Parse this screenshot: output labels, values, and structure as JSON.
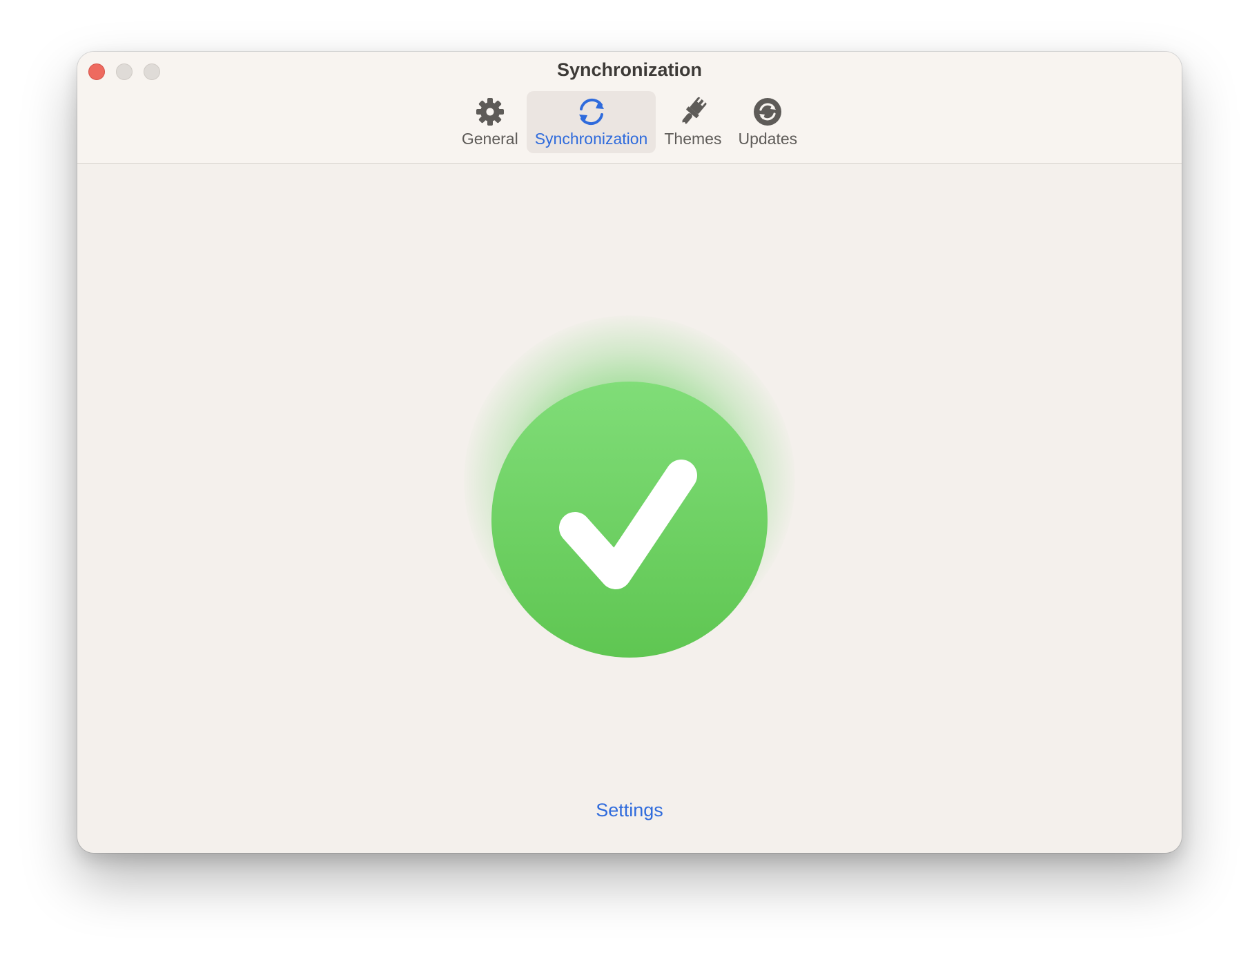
{
  "window": {
    "title": "Synchronization"
  },
  "toolbar": {
    "tabs": [
      {
        "label": "General",
        "icon": "gear-icon",
        "selected": false
      },
      {
        "label": "Synchronization",
        "icon": "sync-icon",
        "selected": true
      },
      {
        "label": "Themes",
        "icon": "paintbrush-icon",
        "selected": false
      },
      {
        "label": "Updates",
        "icon": "updates-icon",
        "selected": false
      }
    ]
  },
  "main": {
    "status_icon": "checkmark-circle-icon",
    "settings_label": "Settings"
  },
  "colors": {
    "accent": "#2f6bdc",
    "success_green": "#66cc5c",
    "close_button": "#ee6a5f"
  }
}
